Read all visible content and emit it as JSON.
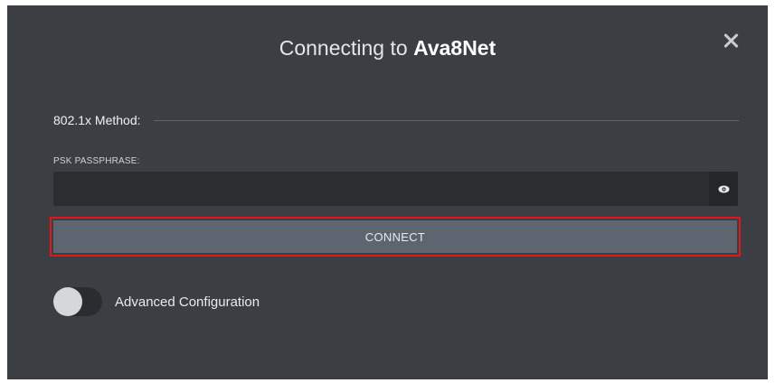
{
  "dialog": {
    "title_prefix": "Connecting to ",
    "network_name": "Ava8Net",
    "close_icon": "close-icon"
  },
  "method": {
    "label": "802.1x Method:"
  },
  "psk": {
    "label": "PSK PASSPHRASE:",
    "value": "",
    "placeholder": "",
    "toggle_icon": "eye-icon"
  },
  "connect": {
    "label": "CONNECT",
    "highlight_color": "#e0161b"
  },
  "advanced": {
    "label": "Advanced Configuration",
    "enabled": false
  },
  "colors": {
    "dialog_bg": "#3b3f43",
    "input_bg": "#2b2e31",
    "button_bg": "#5d6670"
  }
}
